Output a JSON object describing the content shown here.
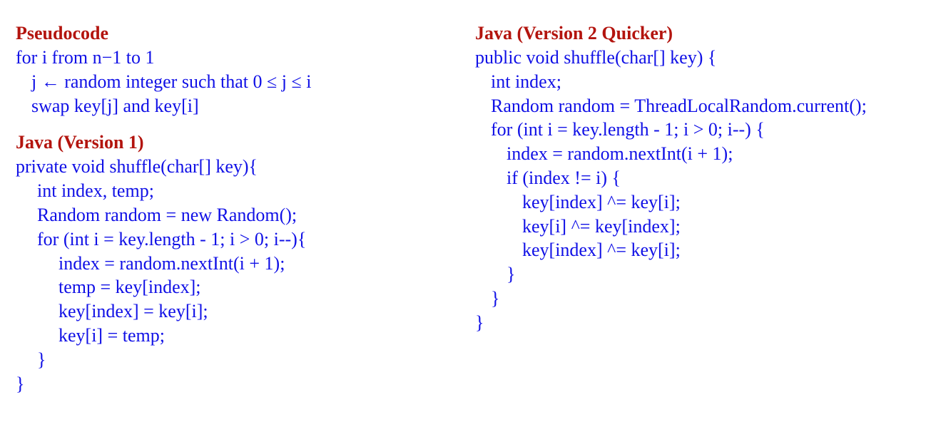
{
  "pseudocode": {
    "heading": "Pseudocode",
    "lines": [
      {
        "text": "for i from n−1 to 1",
        "indent": 0
      },
      {
        "text": "j ← random integer such that 0 ≤ j ≤ i",
        "indent": 1
      },
      {
        "text": "swap key[j] and key[i]",
        "indent": 1
      }
    ]
  },
  "java_v1": {
    "heading": "Java (Version 1)",
    "lines": [
      {
        "text": "private void shuffle(char[] key){",
        "indent": 0
      },
      {
        "text": "int index, temp;",
        "indent": 1
      },
      {
        "text": "Random random = new Random();",
        "indent": 1
      },
      {
        "text": "for (int i = key.length - 1; i > 0; i--){",
        "indent": 1
      },
      {
        "text": "index = random.nextInt(i + 1);",
        "indent": 2
      },
      {
        "text": "temp = key[index];",
        "indent": 2
      },
      {
        "text": "key[index] = key[i];",
        "indent": 2
      },
      {
        "text": "key[i] = temp;",
        "indent": 2
      },
      {
        "text": "}",
        "indent": 1
      },
      {
        "text": "}",
        "indent": 0
      }
    ]
  },
  "java_v2": {
    "heading": "Java (Version 2 Quicker)",
    "lines": [
      {
        "text": "public void shuffle(char[] key) {",
        "indent": 0
      },
      {
        "text": "int index;",
        "indent": 1
      },
      {
        "text": "Random random = ThreadLocalRandom.current();",
        "indent": 1
      },
      {
        "text": "for (int i = key.length - 1; i > 0; i--) {",
        "indent": 1
      },
      {
        "text": "index = random.nextInt(i + 1);",
        "indent": 2
      },
      {
        "text": "if (index != i) {",
        "indent": 2
      },
      {
        "text": "key[index] ^= key[i];",
        "indent": 3
      },
      {
        "text": "key[i] ^= key[index];",
        "indent": 3
      },
      {
        "text": "key[index] ^= key[i];",
        "indent": 3
      },
      {
        "text": "}",
        "indent": 2
      },
      {
        "text": "}",
        "indent": 1
      },
      {
        "text": "}",
        "indent": 0
      }
    ]
  },
  "colors": {
    "heading": "#b3140e",
    "code": "#1010e6"
  }
}
